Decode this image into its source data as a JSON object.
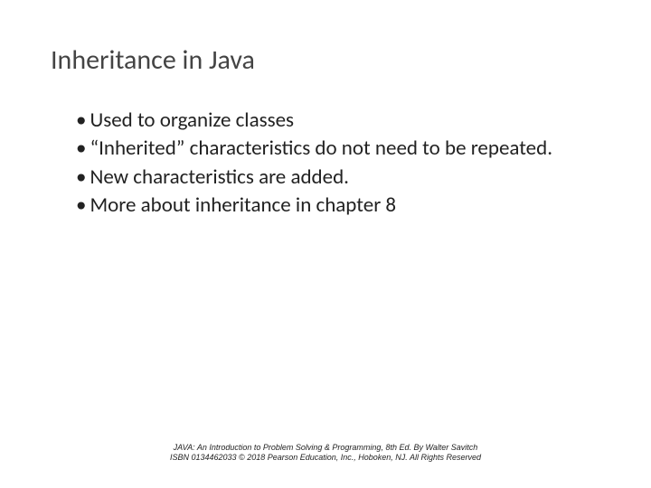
{
  "title": "Inheritance in Java",
  "bullets": [
    "Used to organize classes",
    "“Inherited” characteristics do not need to be repeated.",
    "New characteristics are added.",
    "More about inheritance in chapter 8"
  ],
  "footer": {
    "line1": "JAVA: An Introduction to Problem Solving & Programming, 8th Ed. By Walter Savitch",
    "line2": "ISBN 0134462033 © 2018 Pearson Education, Inc., Hoboken, NJ. All Rights Reserved"
  }
}
